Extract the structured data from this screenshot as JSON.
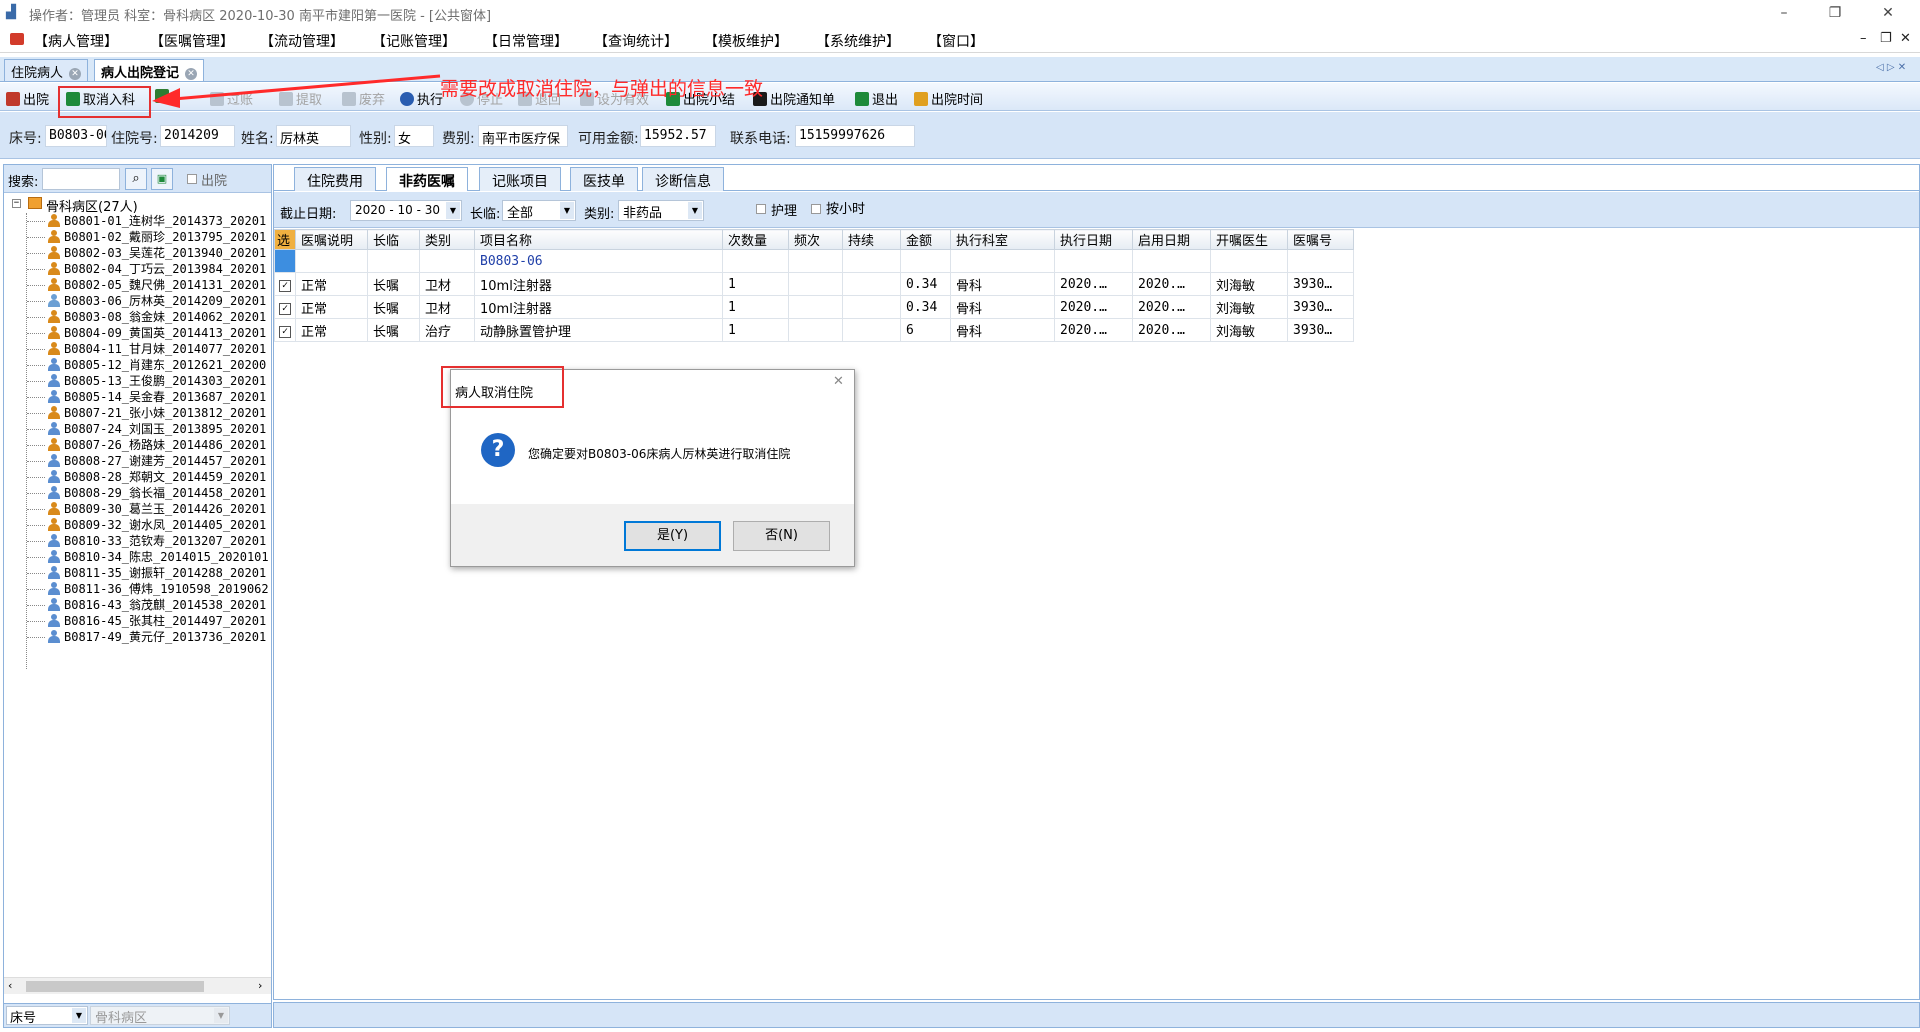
{
  "window": {
    "title": "操作者：管理员  科室：骨科病区  2020-10-30  南平市建阳第一医院 - [公共窗体]",
    "min": "–",
    "restore": "❐",
    "close": "✕"
  },
  "menu": {
    "items": [
      "【病人管理】",
      "【医嘱管理】",
      "【流动管理】",
      "【记账管理】",
      "【日常管理】",
      "【查询统计】",
      "【模板维护】",
      "【系统维护】",
      "【窗口】"
    ],
    "mdi_min": "–",
    "mdi_restore": "❐",
    "mdi_close": "✕"
  },
  "doc_tabs": [
    {
      "label": "住院病人"
    },
    {
      "label": "病人出院登记"
    }
  ],
  "doc_tab_nav": "◁ ▷ ✕",
  "toolbar": {
    "items": [
      {
        "label": "出院",
        "enabled": true,
        "color": "#c0392b"
      },
      {
        "label": "取消入科",
        "enabled": true,
        "color": "#1e8a3a"
      },
      {
        "label": "",
        "enabled": true,
        "color": "#2e7d32"
      },
      {
        "label": "过账",
        "enabled": false,
        "color": "#9aa7b5"
      },
      {
        "label": "提取",
        "enabled": false,
        "color": "#9aa7b5"
      },
      {
        "label": "废弃",
        "enabled": false,
        "color": "#9aa7b5"
      },
      {
        "label": "执行",
        "enabled": true,
        "color": "#2a5db0"
      },
      {
        "label": "停止",
        "enabled": false,
        "color": "#9aa7b5"
      },
      {
        "label": "退回",
        "enabled": false,
        "color": "#9aa7b5"
      },
      {
        "label": "设为有效",
        "enabled": false,
        "color": "#9aa7b5"
      },
      {
        "label": "出院小结",
        "enabled": true,
        "color": "#1e8a3a"
      },
      {
        "label": "出院通知单",
        "enabled": true,
        "color": "#1a1a1a"
      },
      {
        "label": "退出",
        "enabled": true,
        "color": "#1e8a3a"
      },
      {
        "label": "出院时间",
        "enabled": true,
        "color": "#e0a020"
      }
    ]
  },
  "patient": {
    "bed_label": "床号:",
    "bed": "B0803-06",
    "admission_label": "住院号:",
    "admission_no": "2014209",
    "name_label": "姓名:",
    "name": "厉林英",
    "sex_label": "性别:",
    "sex": "女",
    "fee_label": "费别:",
    "fee_type": "南平市医疗保",
    "balance_label": "可用金额:",
    "balance": "15952.57",
    "phone_label": "联系电话:",
    "phone": "15159997626"
  },
  "search": {
    "label": "搜索:",
    "value": "",
    "discharged_label": "出院"
  },
  "tree": {
    "root": "骨科病区(27人)",
    "patients": [
      {
        "text": "B0801-01_连树华_2014373_20201",
        "color": "#d98a1b"
      },
      {
        "text": "B0801-02_戴丽珍_2013795_20201",
        "color": "#d98a1b"
      },
      {
        "text": "B0802-03_吴莲花_2013940_20201",
        "color": "#d98a1b"
      },
      {
        "text": "B0802-04_丁巧云_2013984_20201",
        "color": "#d98a1b"
      },
      {
        "text": "B0802-05_魏尺佛_2014131_20201",
        "color": "#d98a1b"
      },
      {
        "text": "B0803-06_厉林英_2014209_20201",
        "color": "#6b9fd4"
      },
      {
        "text": "B0803-08_翁金妹_2014062_20201",
        "color": "#d98a1b"
      },
      {
        "text": "B0804-09_黄国英_2014413_20201",
        "color": "#d98a1b"
      },
      {
        "text": "B0804-11_甘月妹_2014077_20201",
        "color": "#d98a1b"
      },
      {
        "text": "B0805-12_肖建东_2012621_20200",
        "color": "#5b8ed0"
      },
      {
        "text": "B0805-13_王俊鹏_2014303_20201",
        "color": "#5b8ed0"
      },
      {
        "text": "B0805-14_吴金春_2013687_20201",
        "color": "#5b8ed0"
      },
      {
        "text": "B0807-21_张小妹_2013812_20201",
        "color": "#d98a1b"
      },
      {
        "text": "B0807-24_刘国玉_2013895_20201",
        "color": "#5b8ed0"
      },
      {
        "text": "B0807-26_杨路妹_2014486_20201",
        "color": "#d98a1b"
      },
      {
        "text": "B0808-27_谢建芳_2014457_20201",
        "color": "#5b8ed0"
      },
      {
        "text": "B0808-28_郑朝文_2014459_20201",
        "color": "#5b8ed0"
      },
      {
        "text": "B0808-29_翁长福_2014458_20201",
        "color": "#5b8ed0"
      },
      {
        "text": "B0809-30_葛兰玉_2014426_20201",
        "color": "#d98a1b"
      },
      {
        "text": "B0809-32_谢水凤_2014405_20201",
        "color": "#d98a1b"
      },
      {
        "text": "B0810-33_范钦寿_2013207_20201",
        "color": "#5b8ed0"
      },
      {
        "text": "B0810-34_陈忠_2014015_2020101",
        "color": "#5b8ed0"
      },
      {
        "text": "B0811-35_谢振轩_2014288_20201",
        "color": "#5b8ed0"
      },
      {
        "text": "B0811-36_傅炜_1910598_2019062",
        "color": "#5b8ed0"
      },
      {
        "text": "B0816-43_翁茂麒_2014538_20201",
        "color": "#5b8ed0"
      },
      {
        "text": "B0816-45_张其柱_2014497_20201",
        "color": "#5b8ed0"
      },
      {
        "text": "B0817-49_黄元仔_2013736_20201",
        "color": "#5b8ed0"
      }
    ]
  },
  "left_bottom": {
    "sort_value": "床号",
    "ward_value": "骨科病区"
  },
  "sub_tabs": [
    "住院费用",
    "非药医嘱",
    "记账项目",
    "医技单",
    "诊断信息"
  ],
  "filters": {
    "date_label": "截止日期:",
    "date_value": "2020 - 10 - 30",
    "longterm_label": "长临:",
    "longterm_value": "全部",
    "type_label": "类别:",
    "type_value": "非药品",
    "nursing_label": "护理",
    "hourly_label": "按小时"
  },
  "grid": {
    "select_header": "选",
    "columns": [
      "医嘱说明",
      "长临",
      "类别",
      "项目名称",
      "次数量",
      "频次",
      "持续",
      "金额",
      "执行科室",
      "执行日期",
      "启用日期",
      "开嘱医生",
      "医嘱号"
    ],
    "group_label": "B0803-06",
    "rows": [
      {
        "checked": "✓",
        "cells": [
          "正常",
          "长嘱",
          "卫材",
          "10ml注射器",
          "1",
          "",
          "",
          "0.34",
          "骨科",
          "2020.…",
          "2020.…",
          "刘海敏",
          "3930…"
        ]
      },
      {
        "checked": "✓",
        "cells": [
          "正常",
          "长嘱",
          "卫材",
          "10ml注射器",
          "1",
          "",
          "",
          "0.34",
          "骨科",
          "2020.…",
          "2020.…",
          "刘海敏",
          "3930…"
        ]
      },
      {
        "checked": "✓",
        "cells": [
          "正常",
          "长嘱",
          "治疗",
          "动静脉置管护理",
          "1",
          "",
          "",
          "6",
          "骨科",
          "2020.…",
          "2020.…",
          "刘海敏",
          "3930…"
        ]
      }
    ]
  },
  "dialog": {
    "title": "病人取消住院",
    "close": "✕",
    "icon": "?",
    "message": "您确定要对B0803-06床病人厉林英进行取消住院",
    "yes": "是(Y)",
    "no": "否(N)"
  },
  "annotation": {
    "text": "需要改成取消住院，与弹出的信息一致",
    "color": "#ff2a2a"
  }
}
